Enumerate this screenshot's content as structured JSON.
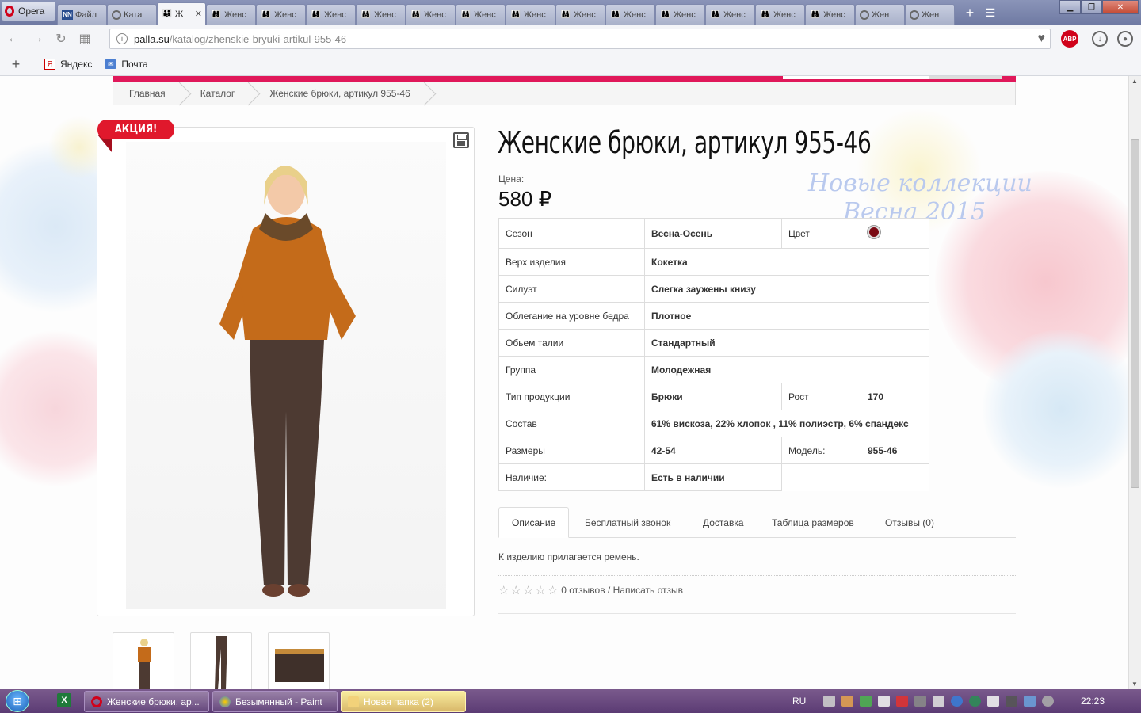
{
  "browser": {
    "app_name": "Opera",
    "tabs": [
      {
        "icon": "nn-icon",
        "label": "Файл"
      },
      {
        "icon": "loading-icon",
        "label": "Ката"
      },
      {
        "icon": "people-icon",
        "label": "Ж",
        "active": true
      },
      {
        "icon": "people-icon",
        "label": "Женс"
      },
      {
        "icon": "people-icon",
        "label": "Женс"
      },
      {
        "icon": "people-icon",
        "label": "Женс"
      },
      {
        "icon": "people-icon",
        "label": "Женс"
      },
      {
        "icon": "people-icon",
        "label": "Женс"
      },
      {
        "icon": "people-icon",
        "label": "Женс"
      },
      {
        "icon": "people-icon",
        "label": "Женс"
      },
      {
        "icon": "people-icon",
        "label": "Женс"
      },
      {
        "icon": "people-icon",
        "label": "Женс"
      },
      {
        "icon": "people-icon",
        "label": "Женс"
      },
      {
        "icon": "people-icon",
        "label": "Женс"
      },
      {
        "icon": "people-icon",
        "label": "Женс"
      },
      {
        "icon": "people-icon",
        "label": "Женс"
      },
      {
        "icon": "loading-icon",
        "label": "Жен"
      },
      {
        "icon": "loading-icon",
        "label": "Жен"
      }
    ],
    "url_host": "palla.su",
    "url_path": "/katalog/zhenskie-bryuki-artikul-955-46",
    "adblock_label": "ABP",
    "bookmarks": [
      {
        "icon": "yandex-icon",
        "label": "Яндекс"
      },
      {
        "icon": "mail-icon",
        "label": "Почта"
      }
    ]
  },
  "page": {
    "breadcrumbs": [
      "Главная",
      "Каталог",
      "Женские брюки, артикул 955-46"
    ],
    "sale_badge": "АКЦИЯ!",
    "title": "Женские брюки, артикул 955-46",
    "price_label": "Цена:",
    "price": "580 ₽",
    "watermark_line1": "Новые коллекции",
    "watermark_line2": "Весна 2015",
    "specs": {
      "season_label": "Сезон",
      "season": "Весна-Осень",
      "color_label": "Цвет",
      "color_hex": "#7a0a14",
      "top_label": "Верх изделия",
      "top": "Кокетка",
      "silhouette_label": "Силуэт",
      "silhouette": "Слегка заужены книзу",
      "hip_label": "Облегание на уровне бедра",
      "hip": "Плотное",
      "waist_label": "Обьем талии",
      "waist": "Стандартный",
      "group_label": "Группа",
      "group": "Молодежная",
      "type_label": "Тип продукции",
      "type": "Брюки",
      "height_label": "Рост",
      "height": "170",
      "composition_label": "Состав",
      "composition": "61% вискоза, 22% хлопок , 11% полиэстр, 6% спандекс",
      "sizes_label": "Размеры",
      "sizes": "42-54",
      "model_label": "Модель:",
      "model": "955-46",
      "availability_label": "Наличие:",
      "availability": "Есть в наличии"
    },
    "tabs": [
      "Описание",
      "Бесплатный звонок",
      "Доставка",
      "Таблица размеров",
      "Отзывы (0)"
    ],
    "description": "К изделию прилагается ремень.",
    "reviews_text": "0 отзывов / Написать отзыв",
    "rating": 0
  },
  "taskbar": {
    "items": [
      {
        "label": "Женские брюки, ар...",
        "icon": "opera-icon"
      },
      {
        "label": "Безымянный - Paint",
        "icon": "paint-icon"
      },
      {
        "label": "Новая папка (2)",
        "icon": "folder-icon",
        "active": true
      }
    ],
    "lang": "RU",
    "clock": "22:23"
  }
}
